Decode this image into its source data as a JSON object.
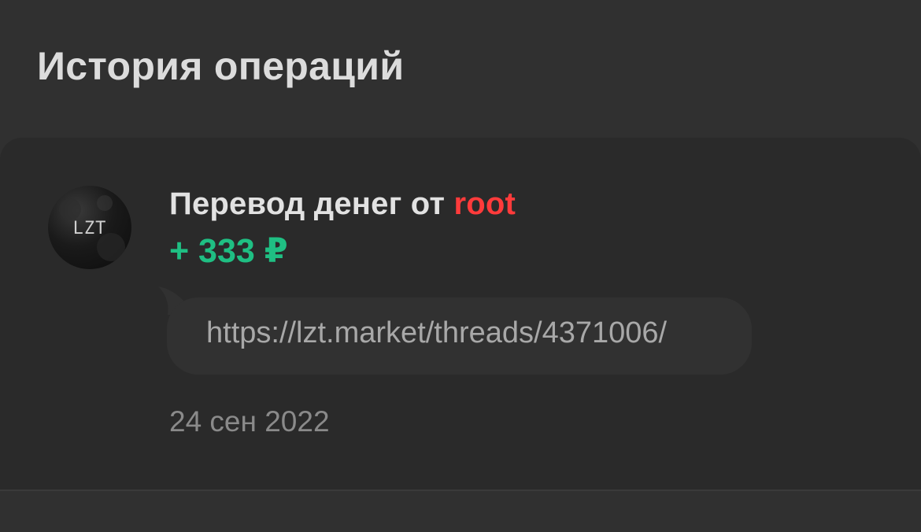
{
  "header": {
    "title": "История операций"
  },
  "transaction": {
    "avatar_text": "LZT",
    "title_prefix": "Перевод денег от ",
    "username": "root",
    "amount": "+ 333 ₽",
    "comment": "https://lzt.market/threads/4371006/",
    "date": "24 сен 2022"
  },
  "colors": {
    "background": "#303030",
    "card": "#2a2a2a",
    "username": "#ff3b3b",
    "amount_positive": "#1fbf83",
    "secondary_text": "#8a8a8a"
  },
  "icons": {
    "avatar": "lzt-logo-avatar"
  }
}
